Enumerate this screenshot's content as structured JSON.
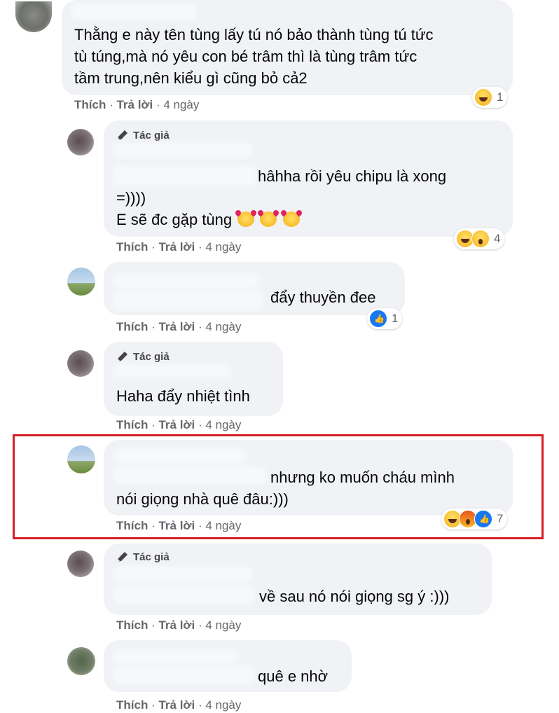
{
  "comments": [
    {
      "author_tag": "",
      "lines": [
        "Thằng e này tên tùng lấy tú nó bảo thành tùng tú tức",
        "tù túng,mà nó yêu con bé trâm thì là tùng trâm tức",
        "tầm trung,nên kiểu gì cũng bỏ cả2"
      ],
      "like": "Thích",
      "reply": "Trả lời",
      "time": "4 ngày",
      "reaction_count": "1"
    },
    {
      "author_tag": "Tác giả",
      "lines": [
        "hâhha rồi yêu chipu là xong",
        "=))))",
        "E sẽ đc gặp tùng"
      ],
      "like": "Thích",
      "reply": "Trả lời",
      "time": "4 ngày",
      "reaction_count": "4"
    },
    {
      "author_tag": "",
      "lines": [
        "đẩy thuyền đee"
      ],
      "like": "Thích",
      "reply": "Trả lời",
      "time": "4 ngày",
      "reaction_count": "1"
    },
    {
      "author_tag": "Tác giả",
      "lines": [
        "Haha đẩy nhiệt tình"
      ],
      "like": "Thích",
      "reply": "Trả lời",
      "time": "4 ngày",
      "reaction_count": ""
    },
    {
      "author_tag": "",
      "lines": [
        "nhưng ko muốn cháu mình",
        "nói giọng nhà quê đâu:)))"
      ],
      "like": "Thích",
      "reply": "Trả lời",
      "time": "4 ngày",
      "reaction_count": "7"
    },
    {
      "author_tag": "Tác giả",
      "lines": [
        "về sau nó nói giọng sg ý :)))"
      ],
      "like": "Thích",
      "reply": "Trả lời",
      "time": "4 ngày",
      "reaction_count": ""
    },
    {
      "author_tag": "",
      "lines": [
        "quê e nhờ"
      ],
      "like": "Thích",
      "reply": "Trả lời",
      "time": "4 ngày",
      "reaction_count": ""
    }
  ],
  "icons": {
    "author_badge": "pencil-icon",
    "reactions": [
      "haha-icon",
      "wow-icon",
      "angry-icon",
      "like-icon"
    ]
  },
  "colors": {
    "bubble": "#f0f2f5",
    "meta_text": "#65676b",
    "highlight_border": "#d61f26",
    "like_blue": "#1877f2"
  }
}
